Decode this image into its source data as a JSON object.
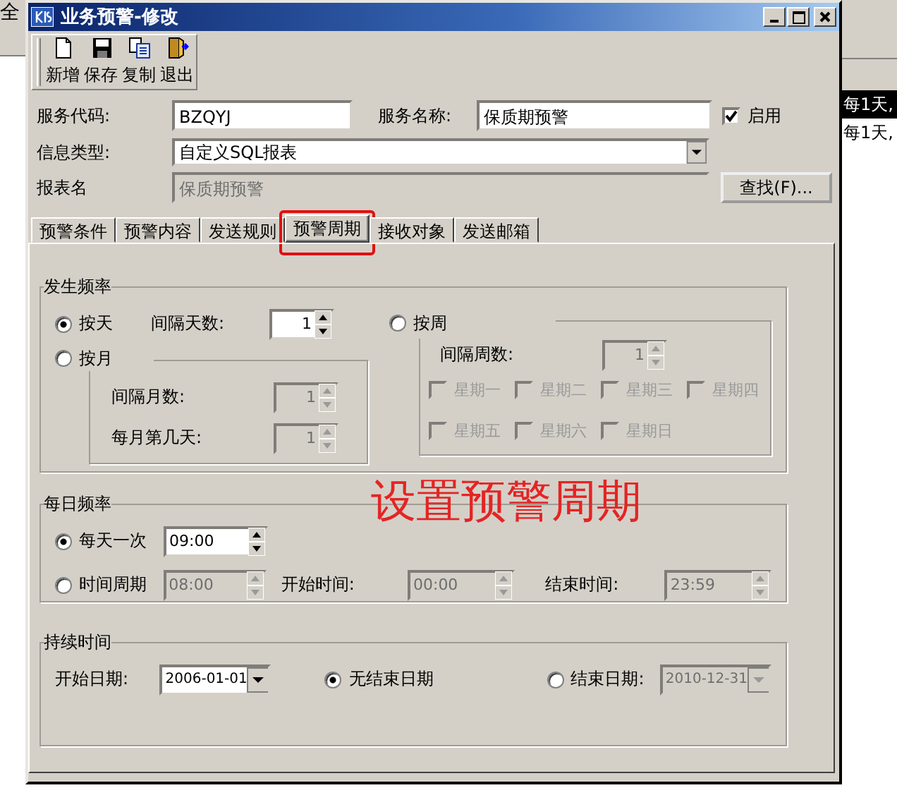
{
  "background_app": {
    "corner_label": "全",
    "rows": [
      {
        "text": "每1天,",
        "selected": true
      },
      {
        "text": "每1天,",
        "selected": false
      }
    ]
  },
  "window": {
    "title": "业务预警-修改"
  },
  "toolbar": [
    {
      "label": "新增",
      "kind": "new"
    },
    {
      "label": "保存",
      "kind": "save"
    },
    {
      "label": "复制",
      "kind": "copy"
    },
    {
      "label": "退出",
      "kind": "exit"
    }
  ],
  "form": {
    "service_code": {
      "label": "服务代码:",
      "value": "BZQYJ"
    },
    "service_name": {
      "label": "服务名称:",
      "value": "保质期预警"
    },
    "enabled": {
      "label": "启用",
      "checked": true
    },
    "info_type": {
      "label": "信息类型:",
      "value": "自定义SQL报表"
    },
    "report_name": {
      "label": "报表名",
      "value": "保质期预警",
      "disabled": true
    },
    "find_button": "查找(F)..."
  },
  "tabs": [
    {
      "label": "预警条件",
      "selected": false,
      "highlighted": false
    },
    {
      "label": "预警内容",
      "selected": false,
      "highlighted": false
    },
    {
      "label": "发送规则",
      "selected": false,
      "highlighted": false
    },
    {
      "label": "预警周期",
      "selected": true,
      "highlighted": true
    },
    {
      "label": "接收对象",
      "selected": false,
      "highlighted": false
    },
    {
      "label": "发送邮箱",
      "selected": false,
      "highlighted": false
    }
  ],
  "frequency": {
    "title": "发生频率",
    "by_day": {
      "label": "按天",
      "selected": true,
      "interval_label": "间隔天数:",
      "interval": "1"
    },
    "by_month": {
      "label": "按月",
      "selected": false,
      "interval_label": "间隔月数:",
      "interval": "1",
      "day_label": "每月第几天:",
      "day": "1"
    },
    "by_week": {
      "label": "按周",
      "selected": false,
      "interval_label": "间隔周数:",
      "interval": "1",
      "weekdays": [
        {
          "label": "星期一",
          "checked": false
        },
        {
          "label": "星期二",
          "checked": false
        },
        {
          "label": "星期三",
          "checked": false
        },
        {
          "label": "星期四",
          "checked": false
        },
        {
          "label": "星期五",
          "checked": false
        },
        {
          "label": "星期六",
          "checked": false
        },
        {
          "label": "星期日",
          "checked": false
        }
      ]
    }
  },
  "daily": {
    "title": "每日频率",
    "once": {
      "label": "每天一次",
      "selected": true,
      "time": "09:00"
    },
    "periodic": {
      "label": "时间周期",
      "selected": false,
      "period": "08:00",
      "start_label": "开始时间:",
      "start": "00:00",
      "end_label": "结束时间:",
      "end": "23:59"
    }
  },
  "duration": {
    "title": "持续时间",
    "start_label": "开始日期:",
    "start": "2006-01-01",
    "no_end": {
      "label": "无结束日期",
      "selected": true
    },
    "end": {
      "label": "结束日期:",
      "selected": false,
      "value": "2010-12-31"
    }
  },
  "annotation": "设置预警周期"
}
